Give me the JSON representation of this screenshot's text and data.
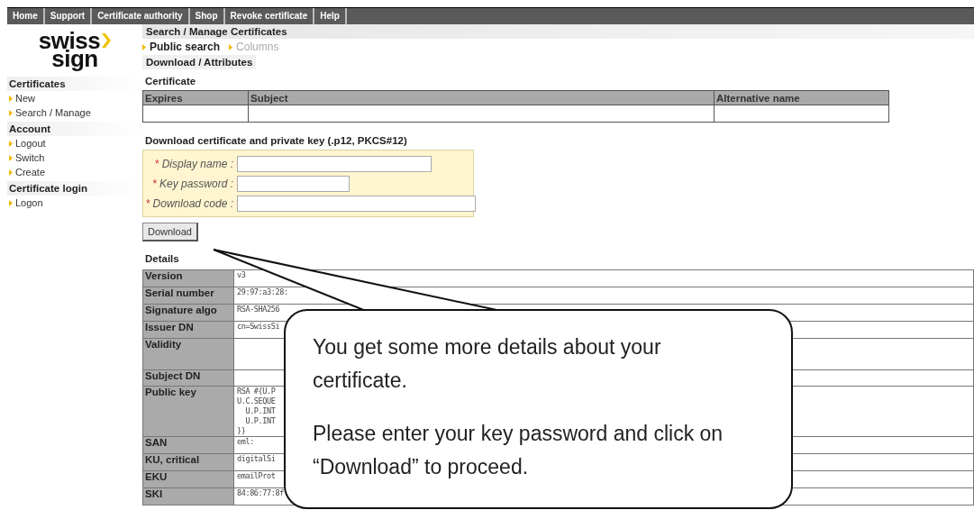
{
  "nav": [
    {
      "label": "Home"
    },
    {
      "label": "Support"
    },
    {
      "label": "Certificate authority"
    },
    {
      "label": "Shop"
    },
    {
      "label": "Revoke certificate"
    },
    {
      "label": "Help"
    }
  ],
  "logo": {
    "line1": "swiss",
    "line2": "sign"
  },
  "sidebar": [
    {
      "heading": "Certificates",
      "items": [
        "New",
        "Search / Manage"
      ]
    },
    {
      "heading": "Account",
      "items": [
        "Logout",
        "Switch",
        "Create"
      ]
    },
    {
      "heading": "Certificate login",
      "items": [
        "Logon"
      ]
    }
  ],
  "page_title": "Search / Manage Certificates",
  "subnav": [
    {
      "label": "Public search",
      "disabled": false
    },
    {
      "label": "Columns",
      "disabled": true
    }
  ],
  "section_tab": "Download / Attributes",
  "certificate": {
    "title": "Certificate",
    "columns": [
      "Expires",
      "Subject",
      "Alternative name"
    ]
  },
  "download": {
    "title": "Download certificate and private key (.p12, PKCS#12)",
    "fields": [
      {
        "marker": "*",
        "label": "Display name :"
      },
      {
        "marker": "*",
        "label": "Key password :"
      },
      {
        "marker": "*",
        "label": "Download code :"
      }
    ],
    "button": "Download"
  },
  "details": {
    "title": "Details",
    "rows": [
      {
        "label": "Version",
        "lines": [
          "v3"
        ]
      },
      {
        "label": "Serial number",
        "lines": [
          "29:97:a3:28:"
        ]
      },
      {
        "label": "Signature algo",
        "lines": [
          "RSA-SHA256"
        ]
      },
      {
        "label": "Issuer DN",
        "lines": [
          "cn=SwissSi"
        ]
      },
      {
        "label": "Validity",
        "lines": [],
        "tall": true
      },
      {
        "label": "Subject DN",
        "lines": []
      },
      {
        "label": "Public key",
        "lines": [
          "RSA #{U.P",
          "U.C.SEQUE",
          "  U.P.INT",
          "  U.P.INT",
          "}}"
        ]
      },
      {
        "label": "SAN",
        "lines": [
          "eml:"
        ]
      },
      {
        "label": "KU, critical",
        "lines": [
          "digitalSi"
        ]
      },
      {
        "label": "EKU",
        "lines": [
          "emailProt"
        ]
      },
      {
        "label": "SKI",
        "lines": [
          "84:86:77:8f"
        ]
      }
    ]
  },
  "callout": {
    "paragraphs": [
      "You get some more details about your certificate.",
      "Please enter your key password and click on “Download” to proceed."
    ]
  }
}
